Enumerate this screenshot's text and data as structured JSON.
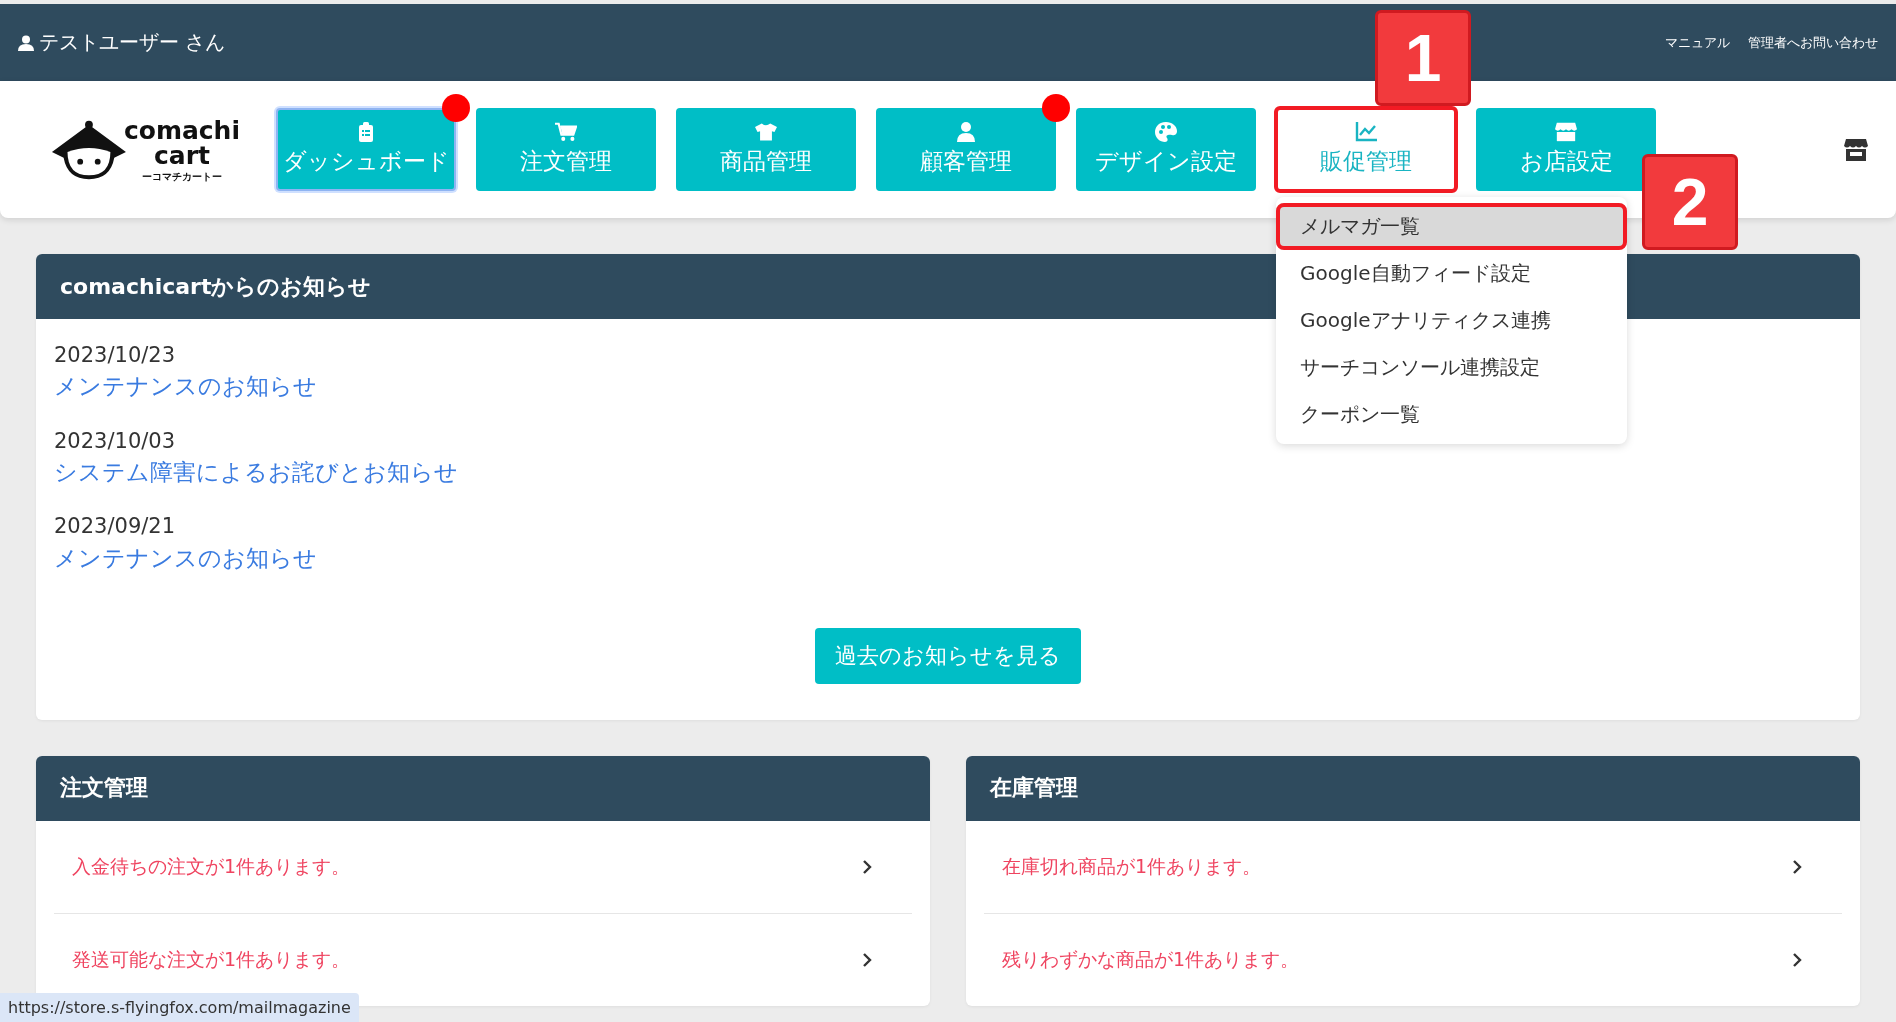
{
  "top_bar": {
    "user": "テストユーザー さん",
    "links": [
      "マニュアル",
      "管理者へお問い合わせ"
    ]
  },
  "logo": {
    "name_line1": "comachi",
    "name_line2": "cart",
    "tagline": "ーコマチカートー"
  },
  "nav": [
    {
      "label": "ダッシュボード",
      "selected": true,
      "expanded": false,
      "badge": true,
      "highlighted": false
    },
    {
      "label": "注文管理",
      "selected": false,
      "expanded": false,
      "badge": false,
      "highlighted": false
    },
    {
      "label": "商品管理",
      "selected": false,
      "expanded": false,
      "badge": false,
      "highlighted": false
    },
    {
      "label": "顧客管理",
      "selected": false,
      "expanded": false,
      "badge": true,
      "highlighted": false
    },
    {
      "label": "デザイン設定",
      "selected": false,
      "expanded": false,
      "badge": false,
      "highlighted": false
    },
    {
      "label": "販促管理",
      "selected": false,
      "expanded": true,
      "badge": false,
      "highlighted": true
    },
    {
      "label": "お店設定",
      "selected": false,
      "expanded": false,
      "badge": false,
      "highlighted": false
    }
  ],
  "dropdown": [
    {
      "label": "メルマガ一覧",
      "selected": true,
      "highlighted": true
    },
    {
      "label": "Google自動フィード設定",
      "selected": false,
      "highlighted": false
    },
    {
      "label": "Googleアナリティクス連携",
      "selected": false,
      "highlighted": false
    },
    {
      "label": "サーチコンソール連携設定",
      "selected": false,
      "highlighted": false
    },
    {
      "label": "クーポン一覧",
      "selected": false,
      "highlighted": false
    }
  ],
  "callouts": [
    "1",
    "2"
  ],
  "notices": {
    "title": "comachicartからのお知らせ",
    "items": [
      {
        "date": "2023/10/23",
        "title": "メンテナンスのお知らせ"
      },
      {
        "date": "2023/10/03",
        "title": "システム障害によるお詫びとお知らせ"
      },
      {
        "date": "2023/09/21",
        "title": "メンテナンスのお知らせ"
      }
    ],
    "button": "過去のお知らせを見る"
  },
  "panels": [
    {
      "title": "注文管理",
      "rows": [
        "入金待ちの注文が1件あります。",
        "発送可能な注文が1件あります。"
      ]
    },
    {
      "title": "在庫管理",
      "rows": [
        "在庫切れ商品が1件あります。",
        "残りわずかな商品が1件あります。"
      ]
    }
  ],
  "status_url": "https://store.s-flyingfox.com/mailmagazine"
}
